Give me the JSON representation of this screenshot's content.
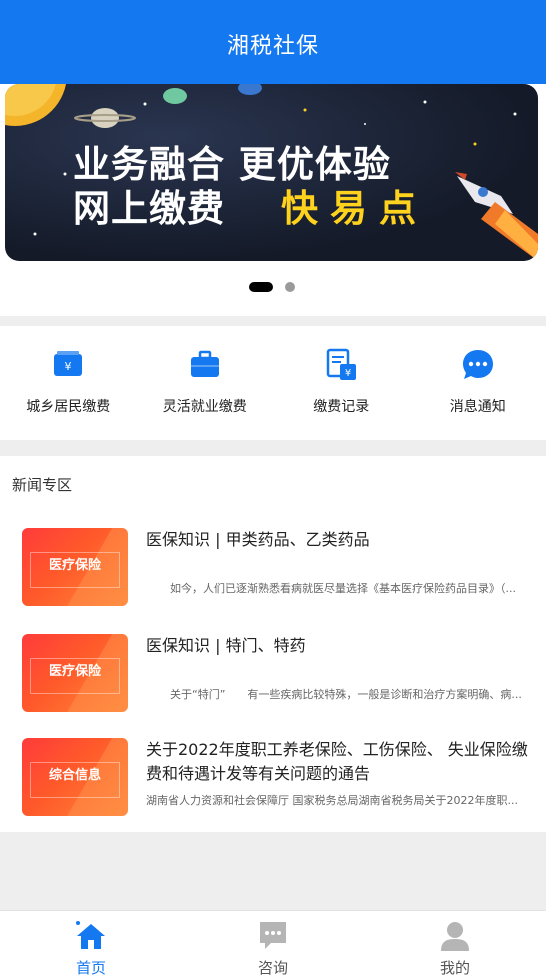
{
  "header": {
    "title": "湘税社保"
  },
  "banner": {
    "line1": "业务融合 更优体验",
    "line2": "网上缴费",
    "accent": "快易点",
    "page_count": 2,
    "active_page": 1
  },
  "quick_actions": [
    {
      "label": "城乡居民缴费",
      "icon": "wallet-yuan-icon"
    },
    {
      "label": "灵活就业缴费",
      "icon": "briefcase-icon"
    },
    {
      "label": "缴费记录",
      "icon": "receipt-yuan-icon"
    },
    {
      "label": "消息通知",
      "icon": "chat-bubble-icon"
    }
  ],
  "news": {
    "section_title": "新闻专区",
    "items": [
      {
        "title": "医保知识 | 甲类药品、乙类药品",
        "snippet": "如今，人们已逐渐熟悉看病就医尽量选择《基本医疗保险药品目录》（...",
        "thumb_label": "医疗保险"
      },
      {
        "title": "医保知识 | 特门、特药",
        "snippet": "关于“特门”　　有一些疾病比较特殊，一般是诊断和治疗方案明确、病...",
        "thumb_label": "医疗保险"
      },
      {
        "title": "关于2022年度职工养老保险、工伤保险、 失业保险缴费和待遇计发等有关问题的通告",
        "snippet": "湖南省人力资源和社会保障厅 国家税务总局湖南省税务局关于2022年度职...",
        "thumb_label": "综合信息"
      }
    ]
  },
  "tabbar": {
    "items": [
      {
        "label": "首页",
        "icon": "home-icon",
        "active": true
      },
      {
        "label": "咨询",
        "icon": "message-icon",
        "active": false
      },
      {
        "label": "我的",
        "icon": "user-icon",
        "active": false
      }
    ]
  },
  "colors": {
    "primary": "#1478f0",
    "banner_accent": "#ffd21e",
    "news_thumb": "#ff3b3b"
  }
}
